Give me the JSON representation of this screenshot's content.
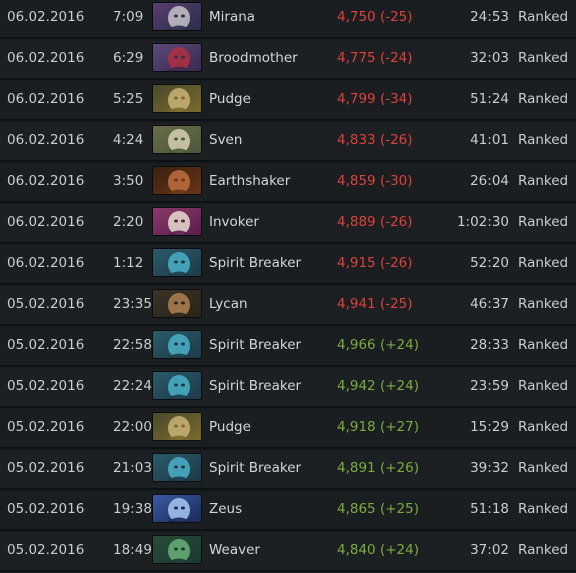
{
  "matches": [
    {
      "date": "06.02.2016",
      "time": "7:09",
      "hero": "Mirana",
      "mmr": "4,750 (-25)",
      "result": "loss",
      "duration": "24:53",
      "mode": "Ranked",
      "portrait_icon": "mirana-portrait-icon",
      "colors": [
        "#2a2f4a",
        "#c7c2c8",
        "#5a3d6e"
      ]
    },
    {
      "date": "06.02.2016",
      "time": "6:29",
      "hero": "Broodmother",
      "mmr": "4,775 (-24)",
      "result": "loss",
      "duration": "32:03",
      "mode": "Ranked",
      "portrait_icon": "broodmother-portrait-icon",
      "colors": [
        "#3a2a4e",
        "#b03040",
        "#5b4a7a"
      ]
    },
    {
      "date": "06.02.2016",
      "time": "5:25",
      "hero": "Pudge",
      "mmr": "4,799 (-34)",
      "result": "loss",
      "duration": "51:24",
      "mode": "Ranked",
      "portrait_icon": "pudge-portrait-icon",
      "colors": [
        "#7a6a30",
        "#c9b474",
        "#4a4a2a"
      ]
    },
    {
      "date": "06.02.2016",
      "time": "4:24",
      "hero": "Sven",
      "mmr": "4,833 (-26)",
      "result": "loss",
      "duration": "41:01",
      "mode": "Ranked",
      "portrait_icon": "sven-portrait-icon",
      "colors": [
        "#4a5a3a",
        "#d8d0b4",
        "#6a6b4a"
      ]
    },
    {
      "date": "06.02.2016",
      "time": "3:50",
      "hero": "Earthshaker",
      "mmr": "4,859 (-30)",
      "result": "loss",
      "duration": "26:04",
      "mode": "Ranked",
      "portrait_icon": "earthshaker-portrait-icon",
      "colors": [
        "#6a3418",
        "#c07040",
        "#3a2010"
      ]
    },
    {
      "date": "06.02.2016",
      "time": "2:20",
      "hero": "Invoker",
      "mmr": "4,889 (-26)",
      "result": "loss",
      "duration": "1:02:30",
      "mode": "Ranked",
      "portrait_icon": "invoker-portrait-icon",
      "colors": [
        "#5a1e4a",
        "#e8dcd0",
        "#8a3a6a"
      ]
    },
    {
      "date": "06.02.2016",
      "time": "1:12",
      "hero": "Spirit Breaker",
      "mmr": "4,915 (-26)",
      "result": "loss",
      "duration": "52:20",
      "mode": "Ranked",
      "portrait_icon": "spirit-breaker-portrait-icon",
      "colors": [
        "#1e3a48",
        "#4ab0c8",
        "#2a5a6a"
      ]
    },
    {
      "date": "05.02.2016",
      "time": "23:35",
      "hero": "Lycan",
      "mmr": "4,941 (-25)",
      "result": "loss",
      "duration": "46:37",
      "mode": "Ranked",
      "portrait_icon": "lycan-portrait-icon",
      "colors": [
        "#2a2418",
        "#b08050",
        "#3a3428"
      ]
    },
    {
      "date": "05.02.2016",
      "time": "22:58",
      "hero": "Spirit Breaker",
      "mmr": "4,966 (+24)",
      "result": "win",
      "duration": "28:33",
      "mode": "Ranked",
      "portrait_icon": "spirit-breaker-portrait-icon",
      "colors": [
        "#1e3a48",
        "#4ab0c8",
        "#2a5a6a"
      ]
    },
    {
      "date": "05.02.2016",
      "time": "22:24",
      "hero": "Spirit Breaker",
      "mmr": "4,942 (+24)",
      "result": "win",
      "duration": "23:59",
      "mode": "Ranked",
      "portrait_icon": "spirit-breaker-portrait-icon",
      "colors": [
        "#1e3a48",
        "#4ab0c8",
        "#2a5a6a"
      ]
    },
    {
      "date": "05.02.2016",
      "time": "22:00",
      "hero": "Pudge",
      "mmr": "4,918 (+27)",
      "result": "win",
      "duration": "15:29",
      "mode": "Ranked",
      "portrait_icon": "pudge-portrait-icon",
      "colors": [
        "#7a6a30",
        "#c9b474",
        "#4a4a2a"
      ]
    },
    {
      "date": "05.02.2016",
      "time": "21:03",
      "hero": "Spirit Breaker",
      "mmr": "4,891 (+26)",
      "result": "win",
      "duration": "39:32",
      "mode": "Ranked",
      "portrait_icon": "spirit-breaker-portrait-icon",
      "colors": [
        "#1e3a48",
        "#4ab0c8",
        "#2a5a6a"
      ]
    },
    {
      "date": "05.02.2016",
      "time": "19:38",
      "hero": "Zeus",
      "mmr": "4,865 (+25)",
      "result": "win",
      "duration": "51:18",
      "mode": "Ranked",
      "portrait_icon": "zeus-portrait-icon",
      "colors": [
        "#1a2a5a",
        "#a8c8f0",
        "#3a5aa0"
      ]
    },
    {
      "date": "05.02.2016",
      "time": "18:49",
      "hero": "Weaver",
      "mmr": "4,840 (+24)",
      "result": "win",
      "duration": "37:02",
      "mode": "Ranked",
      "portrait_icon": "weaver-portrait-icon",
      "colors": [
        "#1a3a30",
        "#6ab07a",
        "#2a4a3a"
      ]
    }
  ],
  "theme": {
    "loss_color": "#e0403a",
    "win_color": "#79ad3d",
    "text_color": "#c9cdd0",
    "background": "#181c1f"
  }
}
